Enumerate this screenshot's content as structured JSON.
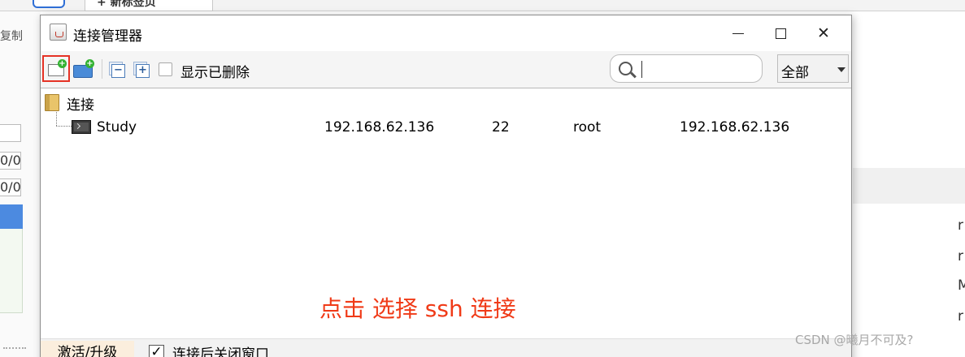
{
  "background": {
    "tab_label": "+ 新标签页",
    "left_text": "复制",
    "left_box_1": "0/0",
    "left_box_2": "0/0",
    "right_chars": [
      "r",
      "r",
      "M",
      "r"
    ],
    "watermark": "CSDN @曦月不可及?"
  },
  "dialog": {
    "title": "连接管理器",
    "window_controls": {
      "minimize": "—",
      "maximize": "□",
      "close": "✕"
    },
    "toolbar": {
      "new_connection_icon": "new-connection-icon",
      "new_folder_icon": "new-folder-icon",
      "collapse_all_icon": "collapse-all-icon",
      "expand_all_icon": "expand-all-icon",
      "show_deleted_label": "显示已删除",
      "show_deleted_checked": false,
      "search_placeholder": "",
      "filter_value": "全部"
    },
    "tree": {
      "folder_label": "连接",
      "connections": [
        {
          "name": "Study",
          "host": "192.168.62.136",
          "port": "22",
          "user": "root",
          "address": "192.168.62.136"
        }
      ]
    },
    "annotation": "点击 选择 ssh 连接",
    "annotation_color": "#f03a17",
    "highlight_color": "#e53225",
    "footer": {
      "activate_label": "激活/升级",
      "close_after_connect_label": "连接后关闭窗口",
      "close_after_connect_checked": true
    }
  }
}
